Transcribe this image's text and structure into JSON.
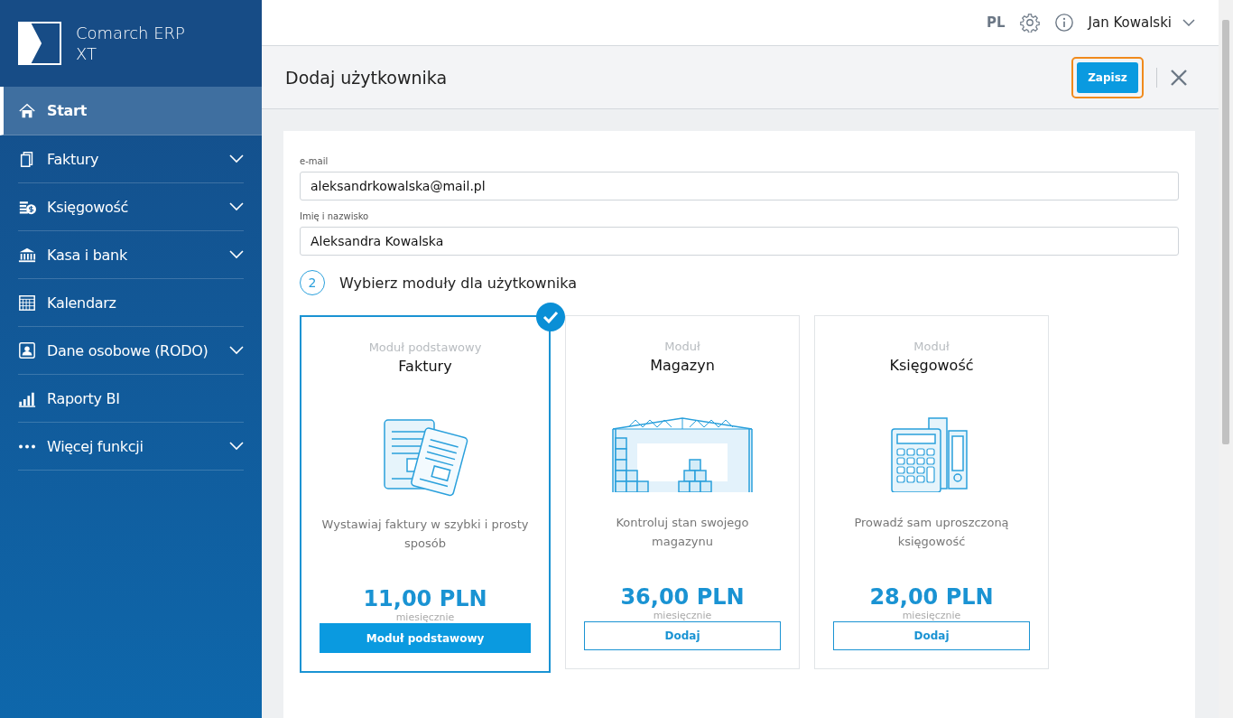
{
  "brand": {
    "name": "Comarch ERP XT"
  },
  "sidebar": {
    "items": [
      {
        "label": "Start",
        "selected": true,
        "expandable": false
      },
      {
        "label": "Faktury",
        "selected": false,
        "expandable": true
      },
      {
        "label": "Księgowość",
        "selected": false,
        "expandable": true
      },
      {
        "label": "Kasa i bank",
        "selected": false,
        "expandable": true
      },
      {
        "label": "Kalendarz",
        "selected": false,
        "expandable": false
      },
      {
        "label": "Dane osobowe (RODO)",
        "selected": false,
        "expandable": true
      },
      {
        "label": "Raporty BI",
        "selected": false,
        "expandable": false
      },
      {
        "label": "Więcej funkcji",
        "selected": false,
        "expandable": true
      }
    ]
  },
  "topbar": {
    "language": "PL",
    "user": "Jan Kowalski"
  },
  "page": {
    "title": "Dodaj użytkownika",
    "save_button": "Zapisz"
  },
  "form": {
    "fields": [
      {
        "label": "e-mail",
        "value": "aleksandrkowalska@mail.pl"
      },
      {
        "label": "Imię i nazwisko",
        "value": "Aleksandra Kowalska"
      }
    ],
    "step": {
      "number": "2",
      "title": "Wybierz moduły dla użytkownika"
    }
  },
  "modules": [
    {
      "label": "Moduł podstawowy",
      "title": "Faktury",
      "description": "Wystawiaj faktury w szybki i prosty sposób",
      "price": "11,00 PLN",
      "period": "miesięcznie",
      "button": "Moduł podstawowy",
      "kind": "basic",
      "selected": true
    },
    {
      "label": "Moduł",
      "title": "Magazyn",
      "description": "Kontroluj stan swojego magazynu",
      "price": "36,00 PLN",
      "period": "miesięcznie",
      "button": "Dodaj",
      "kind": "addon",
      "selected": false
    },
    {
      "label": "Moduł",
      "title": "Księgowość",
      "description": "Prowadź sam uproszczoną księgowość",
      "price": "28,00 PLN",
      "period": "miesięcznie",
      "button": "Dodaj",
      "kind": "addon",
      "selected": false
    }
  ]
}
